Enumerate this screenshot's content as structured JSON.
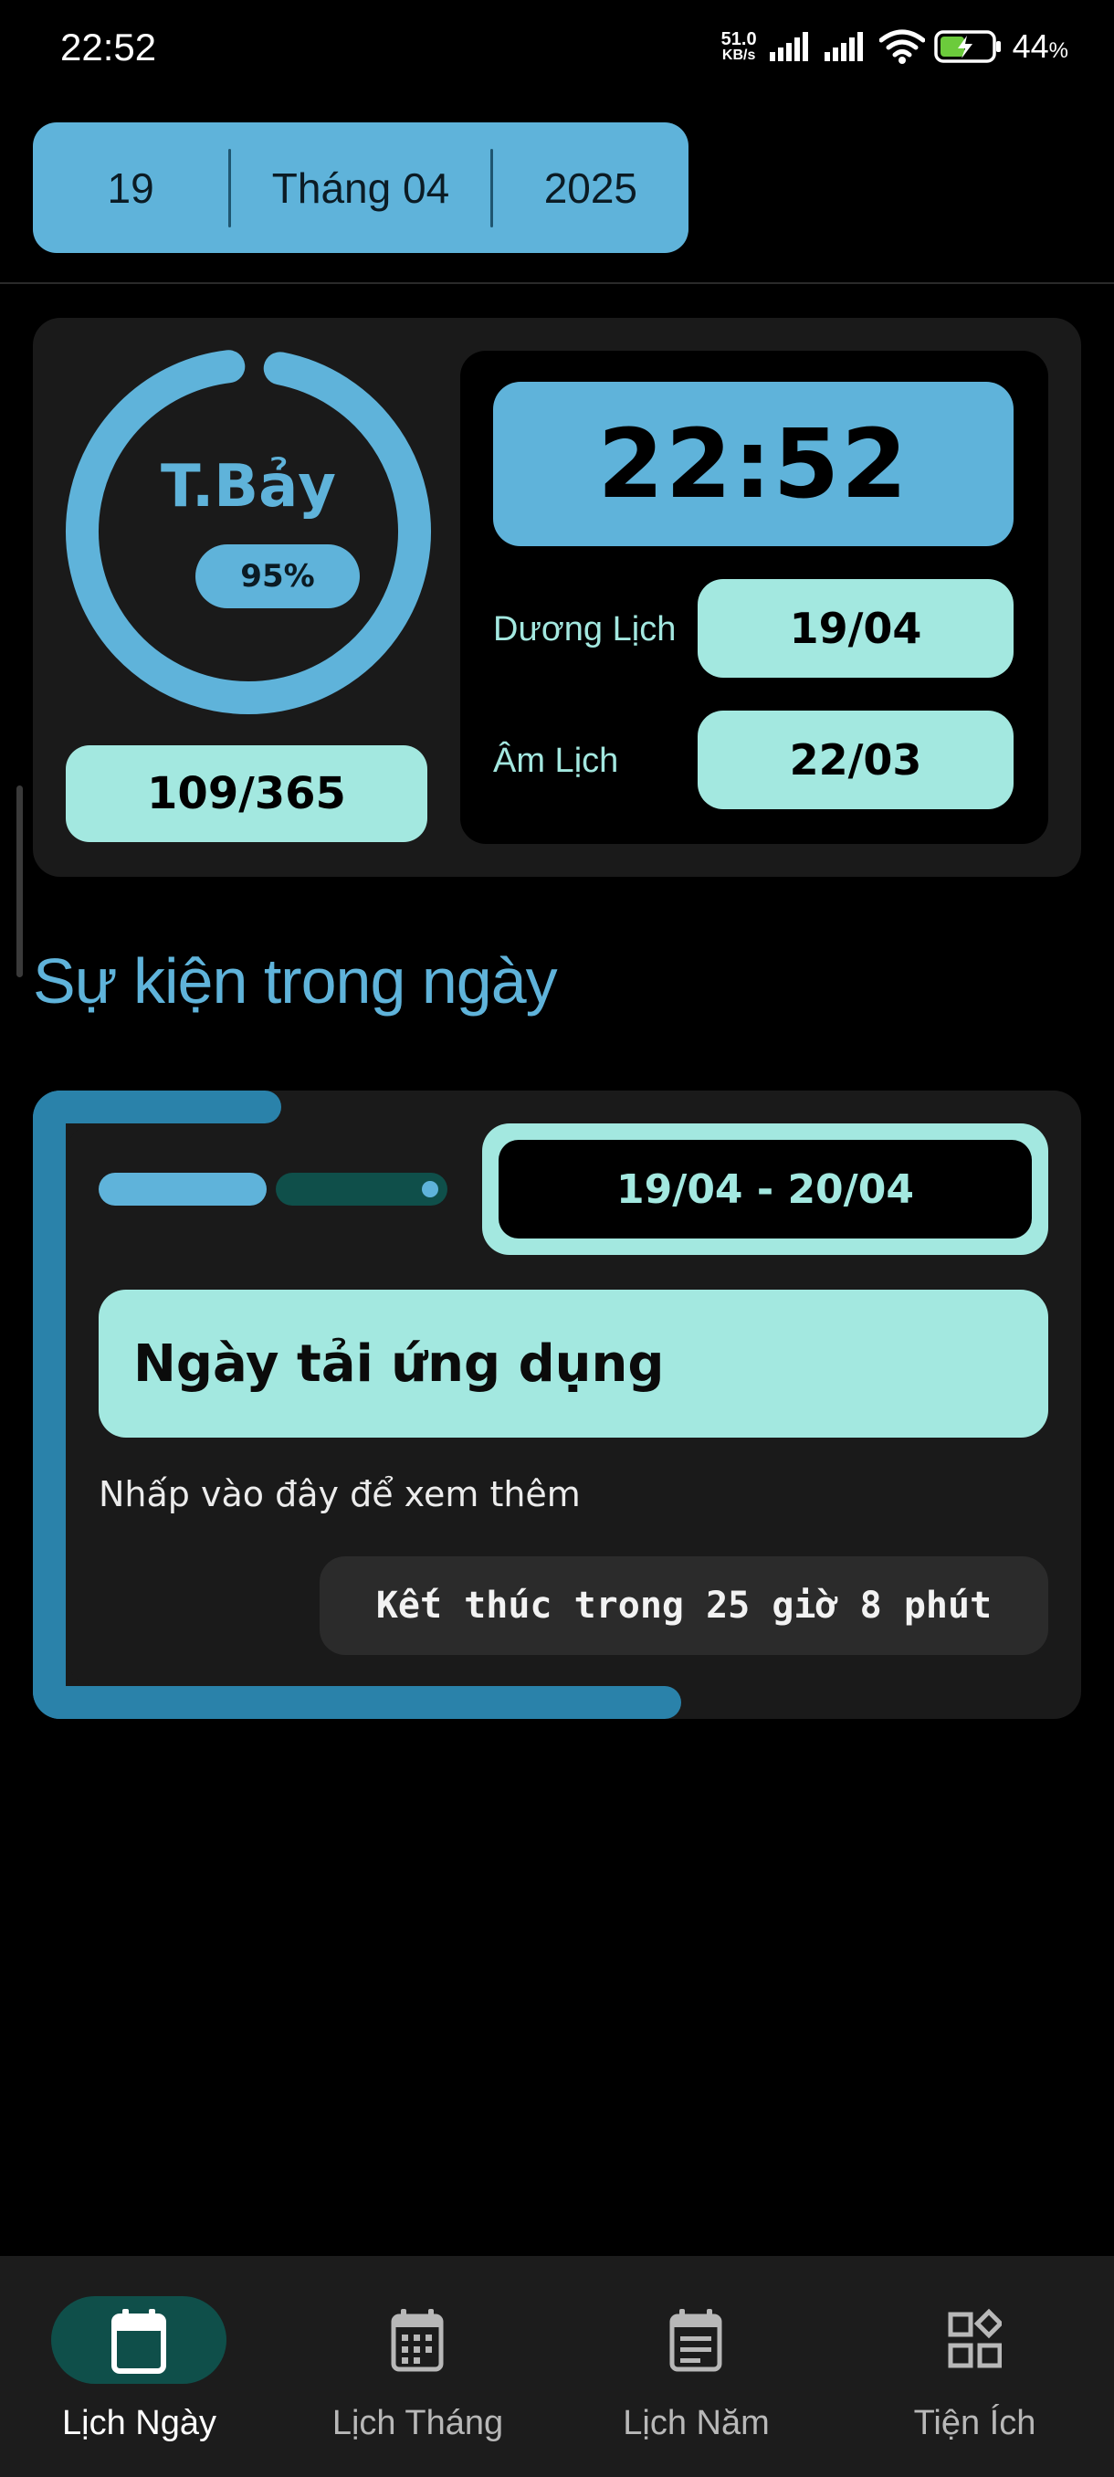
{
  "status_bar": {
    "time": "22:52",
    "net_speed_value": "51.0",
    "net_speed_unit": "KB/s",
    "battery_percent": "44"
  },
  "date_selector": {
    "day": "19",
    "month": "Tháng 04",
    "year": "2025"
  },
  "overview": {
    "weekday": "T.Bảy",
    "day_progress_label": "95%",
    "day_progress_fraction": 0.95,
    "day_of_year": "109/365",
    "clock": "22:52",
    "solar_label": "Dương Lịch",
    "solar_date": "19/04",
    "lunar_label": "Âm Lịch",
    "lunar_date": "22/03"
  },
  "events": {
    "section_title": "Sự kiện trong ngày",
    "items": [
      {
        "date_range": "19/04 - 20/04",
        "title": "Ngày tải ứng dụng",
        "hint": "Nhấp vào đây để xem thêm",
        "countdown": "Kết thúc trong 25 giờ 8 phút"
      }
    ]
  },
  "bottom_nav": {
    "items": [
      {
        "label": "Lịch Ngày",
        "icon": "calendar-day-icon",
        "active": true
      },
      {
        "label": "Lịch Tháng",
        "icon": "calendar-month-icon",
        "active": false
      },
      {
        "label": "Lịch Năm",
        "icon": "calendar-year-icon",
        "active": false
      },
      {
        "label": "Tiện Ích",
        "icon": "widgets-icon",
        "active": false
      }
    ]
  },
  "colors": {
    "accent_blue": "#5fb3da",
    "accent_mint": "#a3e8e0",
    "frame_blue": "#2a82aa",
    "active_nav_bg": "#0f4f4a",
    "card_bg": "#1a1a1a",
    "background": "#000000"
  }
}
